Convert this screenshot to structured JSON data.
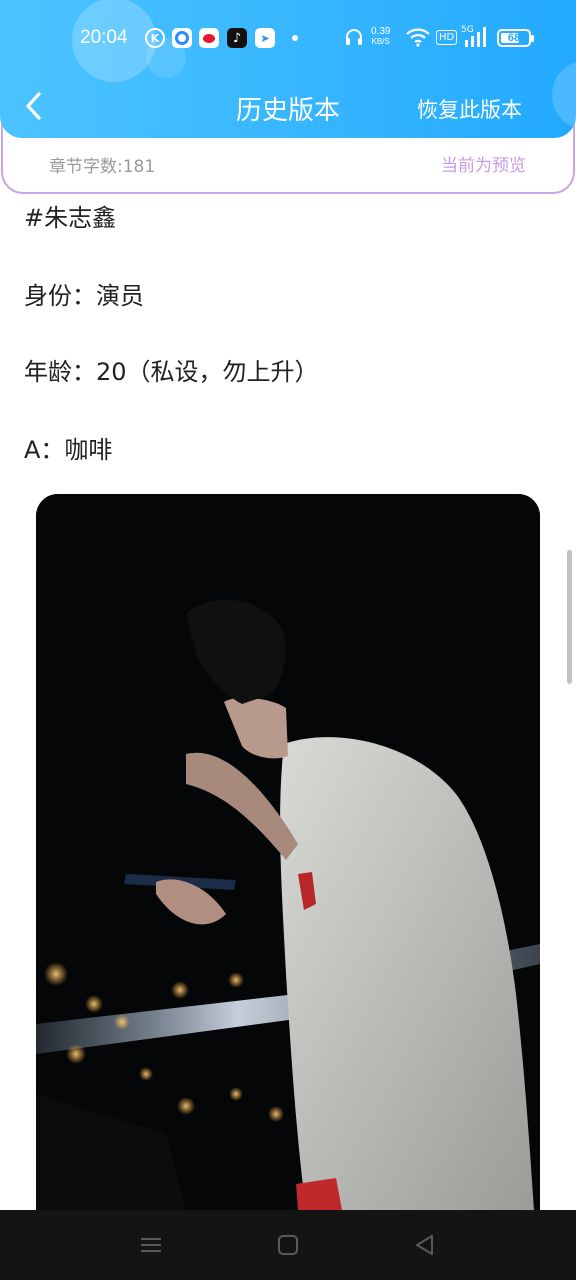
{
  "status_bar": {
    "time": "20:04",
    "net_speed_value": "0.39",
    "net_speed_unit": "KB/S",
    "hd_label": "HD",
    "signal_label": "5G",
    "battery": "68",
    "notification_icons": [
      "k-icon",
      "blue-app-icon",
      "weibo-icon",
      "tiktok-icon",
      "v-app-icon"
    ]
  },
  "header": {
    "title": "历史版本",
    "restore_label": "恢复此版本"
  },
  "info": {
    "word_count": "章节字数:181",
    "preview": "当前为预览"
  },
  "content": {
    "lines": [
      "#朱志鑫",
      "身份：演员",
      "年龄：20（私设，勿上升）",
      "A：咖啡"
    ]
  },
  "colors": {
    "header_gradient_start": "#4cc3ff",
    "header_gradient_end": "#22a9ff",
    "card_border": "#c8a7e8",
    "preview_text": "#c79be6",
    "meta_text": "#9a9a9a",
    "body_text": "#222222",
    "navbar": "#141414"
  }
}
